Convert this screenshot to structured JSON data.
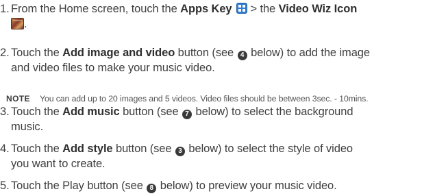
{
  "steps": [
    {
      "number": "1.",
      "pre": "From the Home screen, touch the ",
      "bold1": "Apps Key",
      "icon1": "apps-key-icon",
      "mid": " > the ",
      "bold2": "Video Wiz Icon",
      "icon2": "video-wiz-icon",
      "post": "."
    },
    {
      "number": "2.",
      "pre": "Touch the ",
      "bold": "Add image and video",
      "mid": " button (see ",
      "circle": "4",
      "post": " below) to add the image",
      "line2": "and video files to make your music video."
    },
    {
      "number": "3.",
      "pre": "Touch the ",
      "bold": "Add music",
      "mid": " button (see ",
      "circle": "7",
      "post": " below) to select the background",
      "line2": "music."
    },
    {
      "number": "4.",
      "pre": "Touch the ",
      "bold": "Add style",
      "mid": " button (see ",
      "circle": "3",
      "post": " below) to select the style of video",
      "line2": "you want to create."
    },
    {
      "number": "5.",
      "pre": "Touch the Play button (see ",
      "circle": "8",
      "post": " below) to preview your music video."
    }
  ],
  "note": {
    "label": "NOTE",
    "text": "You can add up to 20 images and 5 videos. Video files should be between 3sec. - 10mins."
  },
  "colors": {
    "text": "#3f3f3f",
    "apps_key_blue": "#2f7fd4"
  }
}
